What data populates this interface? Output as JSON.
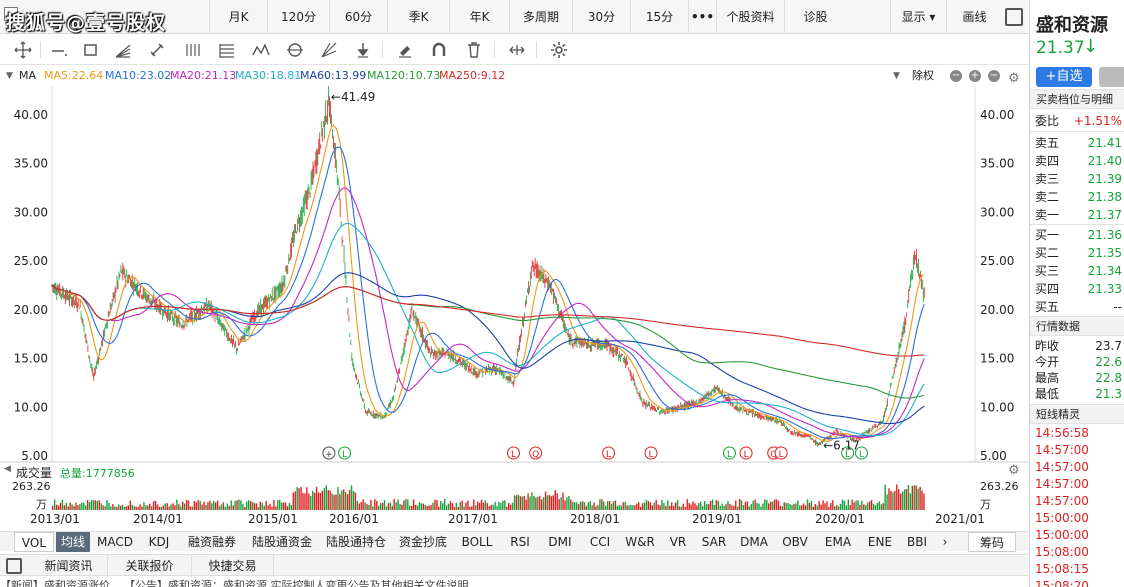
{
  "watermark": "搜狐号@壹号股权",
  "top_tabs": [
    "月K",
    "120分",
    "60分",
    "季K",
    "年K",
    "多周期",
    "30分",
    "15分",
    "•••",
    "个股资料",
    "诊股",
    "显示 ▾",
    "画线"
  ],
  "ma_legend": {
    "label": "MA",
    "items": [
      {
        "text": "MA5:22.64",
        "color": "#e89a1a"
      },
      {
        "text": "MA10:23.02",
        "color": "#2a6fd6"
      },
      {
        "text": "MA20:21.13",
        "color": "#c526c5"
      },
      {
        "text": "MA30:18.81",
        "color": "#1fb2c9"
      },
      {
        "text": "MA60:13.99",
        "color": "#1f3fa8"
      },
      {
        "text": "MA120:10.73",
        "color": "#2a9a3a"
      },
      {
        "text": "MA250:9.12",
        "color": "#d62a2a"
      }
    ],
    "right_label": "除权"
  },
  "chart_data": {
    "type": "candlestick",
    "y_ticks": [
      "40.00",
      "35.00",
      "30.00",
      "25.00",
      "20.00",
      "15.00",
      "10.00",
      "5.00"
    ],
    "ylim": [
      5,
      41.5
    ],
    "x_ticks": [
      "2013/01",
      "2014/01",
      "2015/01",
      "2016/01",
      "2017/01",
      "2018/01",
      "2019/01",
      "2020/01",
      "2021/01"
    ],
    "high_annotation": "←41.49",
    "low_annotation": "←6.17",
    "price_series": [
      [
        0,
        22.5
      ],
      [
        0.03,
        20.5
      ],
      [
        0.045,
        13.0
      ],
      [
        0.06,
        19
      ],
      [
        0.075,
        24.0
      ],
      [
        0.1,
        21.5
      ],
      [
        0.12,
        20
      ],
      [
        0.14,
        18.5
      ],
      [
        0.17,
        20.5
      ],
      [
        0.19,
        17.5
      ],
      [
        0.2,
        16
      ],
      [
        0.22,
        19.5
      ],
      [
        0.25,
        22.5
      ],
      [
        0.265,
        28.5
      ],
      [
        0.28,
        32.5
      ],
      [
        0.3,
        41.49
      ],
      [
        0.31,
        33
      ],
      [
        0.325,
        15
      ],
      [
        0.34,
        9.5
      ],
      [
        0.36,
        9.0
      ],
      [
        0.37,
        11
      ],
      [
        0.39,
        20
      ],
      [
        0.41,
        15.5
      ],
      [
        0.43,
        15.5
      ],
      [
        0.46,
        13.5
      ],
      [
        0.48,
        14
      ],
      [
        0.5,
        12.5
      ],
      [
        0.52,
        24.5
      ],
      [
        0.54,
        22.5
      ],
      [
        0.56,
        17
      ],
      [
        0.58,
        16.5
      ],
      [
        0.6,
        16.5
      ],
      [
        0.62,
        15
      ],
      [
        0.64,
        10.5
      ],
      [
        0.66,
        9.5
      ],
      [
        0.7,
        10.5
      ],
      [
        0.72,
        12
      ],
      [
        0.74,
        10
      ],
      [
        0.77,
        9
      ],
      [
        0.79,
        8.5
      ],
      [
        0.8,
        7.5
      ],
      [
        0.82,
        7.0
      ],
      [
        0.83,
        6.17
      ],
      [
        0.85,
        7.5
      ],
      [
        0.87,
        6.6
      ],
      [
        0.9,
        8.5
      ],
      [
        0.925,
        19
      ],
      [
        0.935,
        26.0
      ],
      [
        0.945,
        21.4
      ]
    ],
    "ma_series_names": [
      "MA5",
      "MA10",
      "MA20",
      "MA30",
      "MA60",
      "MA120",
      "MA250"
    ],
    "markers": [
      "⊕",
      "L",
      "L",
      "Q",
      "L",
      "L",
      "L",
      "L",
      "L",
      "Q",
      "L",
      "L",
      "L"
    ]
  },
  "volume": {
    "title": "成交量",
    "total": "总量:1777856",
    "left_top": "263.26",
    "left_unit": "万",
    "right_top": "263.26",
    "right_unit": "万"
  },
  "indicators": [
    "VOL",
    "均线",
    "MACD",
    "KDJ",
    "融资融券",
    "陆股通资金",
    "陆股通持仓",
    "资金抄底",
    "BOLL",
    "RSI",
    "DMI",
    "CCI",
    "W&R",
    "VR",
    "SAR",
    "DMA",
    "OBV",
    "EMA",
    "ENE",
    "BBI",
    "›",
    "筹码"
  ],
  "news_tabs": [
    "新闻资讯",
    "关联报价",
    "快捷交易"
  ],
  "news_text": "【新闻】盛和资源涨价... 【公告】盛和资源：盛和资源 实际控制人变更公告及其他相关文件说明",
  "right_panel": {
    "stock_name": "盛和资源",
    "price": "21.37",
    "price_arrow": "↓",
    "add_button": "+自选",
    "section_orderbook": "买卖档位与明细",
    "ratio_label": "委比",
    "ratio_value": "+1.51%",
    "sells": [
      {
        "label": "卖五",
        "price": "21.41"
      },
      {
        "label": "卖四",
        "price": "21.40"
      },
      {
        "label": "卖三",
        "price": "21.39"
      },
      {
        "label": "卖二",
        "price": "21.38"
      },
      {
        "label": "卖一",
        "price": "21.37"
      }
    ],
    "buys": [
      {
        "label": "买一",
        "price": "21.36"
      },
      {
        "label": "买二",
        "price": "21.35"
      },
      {
        "label": "买三",
        "price": "21.34"
      },
      {
        "label": "买四",
        "price": "21.33"
      },
      {
        "label": "买五",
        "price": "--"
      }
    ],
    "section_quote": "行情数据",
    "quote": [
      {
        "label": "昨收",
        "value": "23.7"
      },
      {
        "label": "今开",
        "value": "22.6"
      },
      {
        "label": "最高",
        "value": "22.8"
      },
      {
        "label": "最低",
        "value": "21.3"
      }
    ],
    "section_spirit": "短线精灵",
    "times": [
      "14:56:58",
      "14:57:00",
      "14:57:00",
      "14:57:00",
      "14:57:00",
      "15:00:00",
      "15:00:00",
      "15:08:00",
      "15:08:15",
      "15:08:20"
    ],
    "colors": {
      "up": "#e02020",
      "down": "#14a33a",
      "accent": "#2c7be5"
    }
  }
}
